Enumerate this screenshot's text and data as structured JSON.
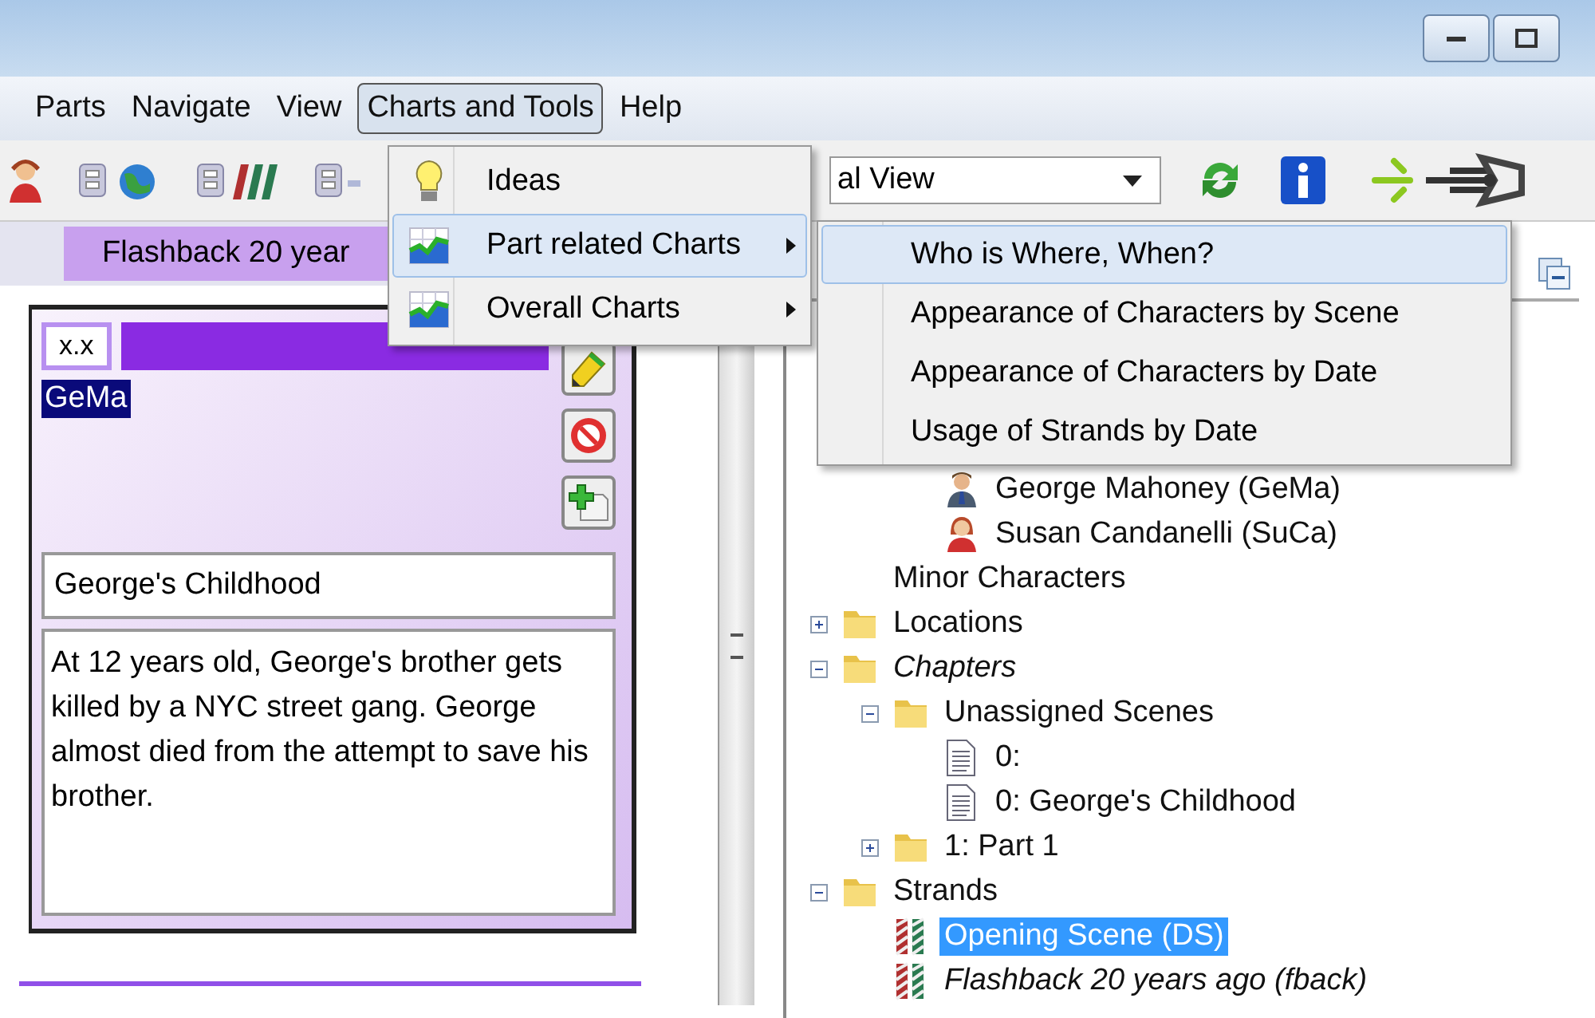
{
  "menu_bar": {
    "items": [
      {
        "label": "Parts",
        "selected": false
      },
      {
        "label": "Navigate",
        "selected": false
      },
      {
        "label": "View",
        "selected": false
      },
      {
        "label": "Charts and Tools",
        "selected": true
      },
      {
        "label": "Help",
        "selected": false
      }
    ]
  },
  "toolbar": {
    "view_combo": {
      "value": "al View"
    }
  },
  "left_panel": {
    "tab": {
      "label": "Flashback 20 year"
    },
    "card": {
      "code": "x.x",
      "abbreviation": "GeMa",
      "title": "George's Childhood",
      "description": "At 12 years old, George's brother gets killed by a NYC street gang. George almost died from the attempt to save his brother."
    }
  },
  "tree": {
    "items": [
      {
        "children": [
          {
            "children": [
              {
                "label": "George Mahoney (GeMa)",
                "kind": "man",
                "selected": false
              },
              {
                "label": "Susan Candanelli (SuCa)",
                "kind": "woman",
                "selected": false
              }
            ]
          },
          {
            "label": "Minor Characters",
            "kind": "plain",
            "selected": false
          }
        ]
      },
      {
        "label": "Locations",
        "kind": "folder",
        "expanded": false,
        "selected": false
      },
      {
        "label": "Chapters",
        "kind": "folder",
        "italic": true,
        "expanded": true,
        "selected": false,
        "children": [
          {
            "label": "Unassigned Scenes",
            "kind": "folder",
            "expanded": true,
            "selected": false,
            "children": [
              {
                "label": "0:",
                "kind": "scene",
                "selected": false
              },
              {
                "label": "0: George's Childhood",
                "kind": "scene",
                "selected": false
              }
            ]
          },
          {
            "label": "1: Part 1",
            "kind": "folder",
            "expanded": false,
            "selected": false
          }
        ]
      },
      {
        "label": "Strands",
        "kind": "folder",
        "expanded": true,
        "selected": false,
        "children": [
          {
            "label": "Opening Scene (DS)",
            "kind": "strand",
            "selected": true
          },
          {
            "label": "Flashback 20 years ago (fback)",
            "kind": "strand",
            "italic": true,
            "selected": false
          }
        ]
      }
    ]
  },
  "dropdown_menu": {
    "items": [
      {
        "label": "Ideas",
        "kind": "bulb",
        "submenu": false,
        "selected": false
      },
      {
        "label": "Part related Charts",
        "kind": "chart",
        "submenu": true,
        "selected": true
      },
      {
        "label": "Overall Charts",
        "kind": "chart",
        "submenu": true,
        "selected": false
      }
    ],
    "submenu": {
      "items": [
        {
          "label": "Who is Where, When?",
          "selected": true
        },
        {
          "label": "Appearance of Characters by Scene",
          "selected": false
        },
        {
          "label": "Appearance of Characters by Date",
          "selected": false
        },
        {
          "label": "Usage of Strands by Date",
          "selected": false
        }
      ]
    }
  }
}
